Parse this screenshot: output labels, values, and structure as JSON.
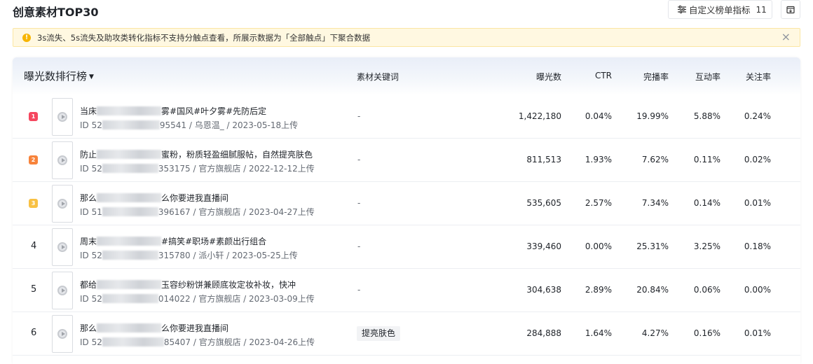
{
  "page": {
    "title": "创意素材TOP30"
  },
  "toolbar": {
    "custom_metrics_label": "自定义榜单指标",
    "custom_metrics_count": "11"
  },
  "notice": {
    "text": "3s流失、5s流失及助攻类转化指标不支持分触点查看，所展示数据为「全部触点」下聚合数据"
  },
  "table": {
    "ranking_title": "曝光数排行榜",
    "columns": {
      "keyword": "素材关键词",
      "exposure": "曝光数",
      "ctr": "CTR",
      "completion": "完播率",
      "interaction": "互动率",
      "follow": "关注率"
    },
    "rows": [
      {
        "rank": "1",
        "title_start": "当床",
        "title_end": "雾#国风#叶夕雾#先防后定",
        "meta_start": "ID 52",
        "meta_end": "95541 / 乌恩温_ / 2023-05-18上传",
        "keyword": "-",
        "exposure": "1,422,180",
        "ctr": "0.04%",
        "completion": "19.99%",
        "interaction": "5.88%",
        "follow": "0.24%"
      },
      {
        "rank": "2",
        "title_start": "防止",
        "title_end": "蜜粉，粉质轻盈细腻服帖，自然提亮肤色",
        "meta_start": "ID 52",
        "meta_end": "353175 / 官方旗舰店 / 2022-12-12上传",
        "keyword": "-",
        "exposure": "811,513",
        "ctr": "1.93%",
        "completion": "7.62%",
        "interaction": "0.11%",
        "follow": "0.02%"
      },
      {
        "rank": "3",
        "title_start": "那么",
        "title_end": "么你要进我直播间",
        "meta_start": "ID 51",
        "meta_end": "396167 / 官方旗舰店 / 2023-04-27上传",
        "keyword": "-",
        "exposure": "535,605",
        "ctr": "2.57%",
        "completion": "7.34%",
        "interaction": "0.14%",
        "follow": "0.01%"
      },
      {
        "rank": "4",
        "title_start": "周末",
        "title_end": "#搞笑#职场#素颜出行组合",
        "meta_start": "ID 52",
        "meta_end": "315780 / 派小轩 / 2023-05-25上传",
        "keyword": "-",
        "exposure": "339,460",
        "ctr": "0.00%",
        "completion": "25.31%",
        "interaction": "3.25%",
        "follow": "0.18%"
      },
      {
        "rank": "5",
        "title_start": "都给",
        "title_end": "玉容纱粉饼兼顾底妆定妆补妆，快冲",
        "meta_start": "ID 52",
        "meta_end": "014022 / 官方旗舰店 / 2023-03-09上传",
        "keyword": "-",
        "exposure": "304,638",
        "ctr": "2.89%",
        "completion": "20.84%",
        "interaction": "0.06%",
        "follow": "0.00%"
      },
      {
        "rank": "6",
        "title_start": "那么",
        "title_end": "么你要进我直播间",
        "meta_start": "ID 52",
        "meta_end": "85407 / 官方旗舰店 / 2023-04-26上传",
        "keyword": "提亮肤色",
        "exposure": "284,888",
        "ctr": "1.64%",
        "completion": "4.27%",
        "interaction": "0.16%",
        "follow": "0.01%"
      }
    ]
  },
  "colors": {
    "rank1": "#f5475f",
    "rank2": "#f7833b",
    "rank3": "#f8c144",
    "warn": "#f7b500",
    "notice_bg": "#fff8e1"
  }
}
